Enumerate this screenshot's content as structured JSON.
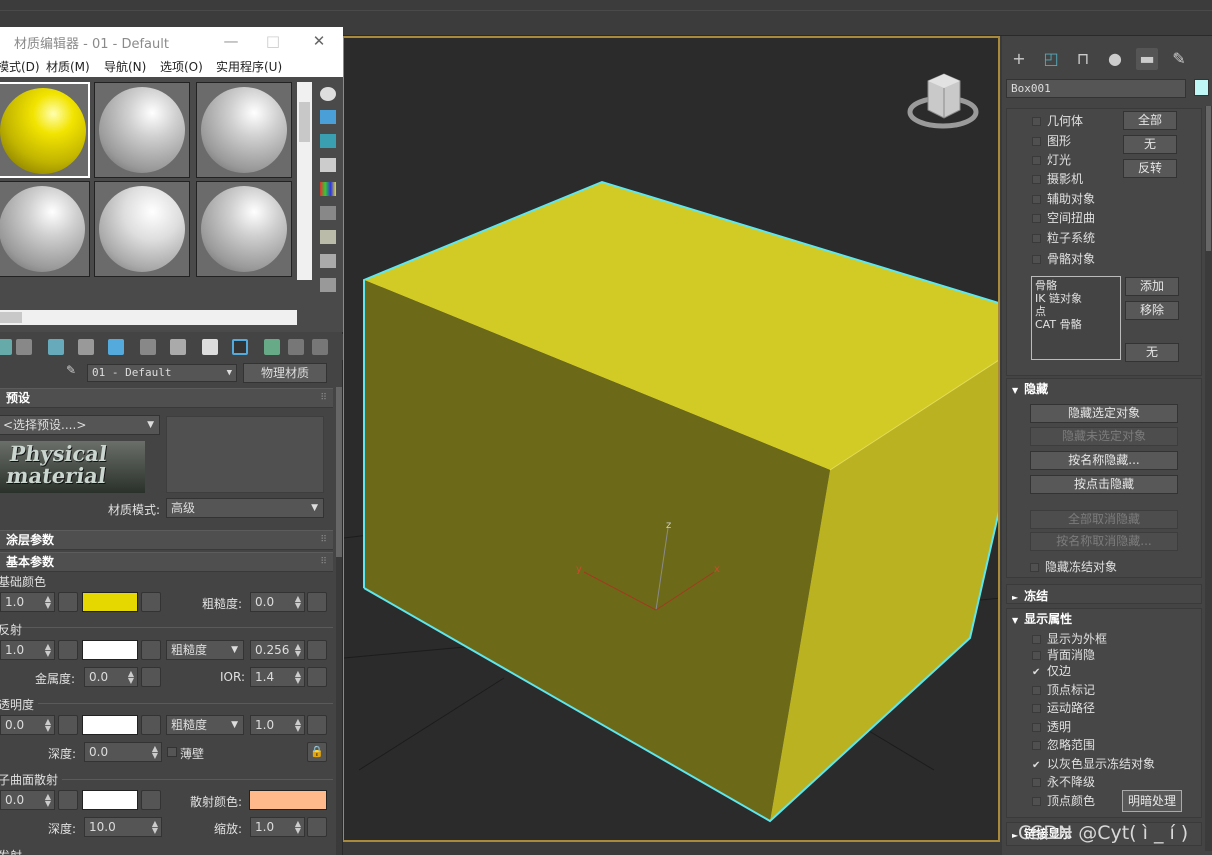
{
  "material_editor": {
    "title": "材质编辑器 - 01 - Default",
    "window_buttons": {
      "minimize": "—",
      "maximize": "□",
      "close": "✕"
    },
    "menu": [
      "模式(D)",
      "材质(M)",
      "导航(N)",
      "选项(O)",
      "实用程序(U)"
    ],
    "material_name": "01 - Default",
    "material_type_button": "物理材质",
    "presets": {
      "header": "预设",
      "select_preset": "<选择预设....>",
      "logo_text": "Physical material",
      "material_mode_label": "材质模式:",
      "material_mode_value": "高级"
    },
    "coating_header": "涂层参数",
    "basic_header": "基本参数",
    "base_color": {
      "label": "基础颜色",
      "weight": "1.0",
      "color": "#e5d800",
      "roughness_label": "粗糙度:",
      "roughness": "0.0"
    },
    "reflection": {
      "label": "反射",
      "weight": "1.0",
      "color": "#ffffff",
      "mode": "粗糙度",
      "roughness": "0.256",
      "metalness_label": "金属度:",
      "metalness": "0.0",
      "ior_label": "IOR:",
      "ior": "1.4"
    },
    "transparency": {
      "label": "透明度",
      "weight": "0.0",
      "color": "#ffffff",
      "mode": "粗糙度",
      "roughness": "1.0",
      "depth_label": "深度:",
      "depth": "0.0",
      "thin_walled_label": "薄壁"
    },
    "sss": {
      "label": "子曲面散射",
      "weight": "0.0",
      "color": "#ffffff",
      "scatter_label": "散射颜色:",
      "scatter_color": "#ffb98a",
      "depth_label": "深度:",
      "depth": "10.0",
      "scale_label": "缩放:",
      "scale": "1.0"
    },
    "emission_label": "发射"
  },
  "viewport": {
    "box_color": "#d4cc26",
    "selection_color": "#5ee7ee",
    "axis_label_z": "z",
    "axis_label_x": "x",
    "axis_label_y": "y"
  },
  "command_panel": {
    "object_name": "Box001",
    "object_color": "#bff7f7",
    "filter_items": [
      "几何体",
      "图形",
      "灯光",
      "摄影机",
      "辅助对象",
      "空间扭曲",
      "粒子系统",
      "骨骼对象"
    ],
    "filter_buttons": [
      "全部",
      "无",
      "反转"
    ],
    "list_items": [
      "骨骼",
      "IK 链对象",
      "点",
      "CAT 骨骼"
    ],
    "list_buttons": [
      "添加",
      "移除",
      "无"
    ],
    "hide": {
      "header": "隐藏",
      "buttons": [
        "隐藏选定对象",
        "隐藏未选定对象",
        "按名称隐藏...",
        "按点击隐藏"
      ],
      "unhide_buttons": [
        "全部取消隐藏",
        "按名称取消隐藏..."
      ],
      "hide_frozen": "隐藏冻结对象"
    },
    "freeze_header": "冻结",
    "display_props": {
      "header": "显示属性",
      "items": [
        {
          "label": "显示为外框",
          "checked": false
        },
        {
          "label": "背面消隐",
          "checked": false
        },
        {
          "label": "仅边",
          "checked": true
        },
        {
          "label": "顶点标记",
          "checked": false
        },
        {
          "label": "运动路径",
          "checked": false
        },
        {
          "label": "透明",
          "checked": false
        },
        {
          "label": "忽略范围",
          "checked": false
        },
        {
          "label": "以灰色显示冻结对象",
          "checked": true
        },
        {
          "label": "永不降级",
          "checked": false
        },
        {
          "label": "顶点颜色",
          "checked": false
        }
      ],
      "shaded_button": "明暗处理"
    },
    "link_display_header": "链接显示"
  },
  "watermark": "CSDN @Cyt( ì _ í )"
}
